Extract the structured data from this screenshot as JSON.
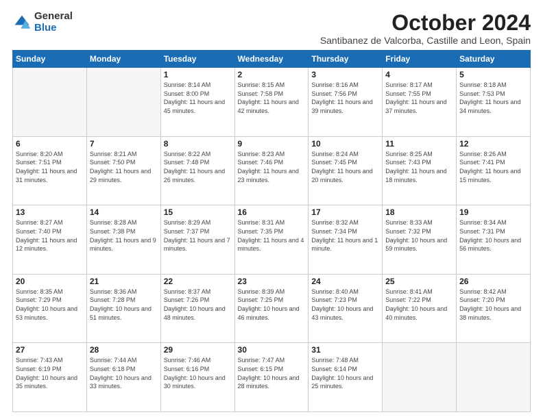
{
  "logo": {
    "general": "General",
    "blue": "Blue"
  },
  "title": {
    "month": "October 2024",
    "location": "Santibanez de Valcorba, Castille and Leon, Spain"
  },
  "weekdays": [
    "Sunday",
    "Monday",
    "Tuesday",
    "Wednesday",
    "Thursday",
    "Friday",
    "Saturday"
  ],
  "weeks": [
    [
      {
        "day": "",
        "info": ""
      },
      {
        "day": "",
        "info": ""
      },
      {
        "day": "1",
        "info": "Sunrise: 8:14 AM\nSunset: 8:00 PM\nDaylight: 11 hours and 45 minutes."
      },
      {
        "day": "2",
        "info": "Sunrise: 8:15 AM\nSunset: 7:58 PM\nDaylight: 11 hours and 42 minutes."
      },
      {
        "day": "3",
        "info": "Sunrise: 8:16 AM\nSunset: 7:56 PM\nDaylight: 11 hours and 39 minutes."
      },
      {
        "day": "4",
        "info": "Sunrise: 8:17 AM\nSunset: 7:55 PM\nDaylight: 11 hours and 37 minutes."
      },
      {
        "day": "5",
        "info": "Sunrise: 8:18 AM\nSunset: 7:53 PM\nDaylight: 11 hours and 34 minutes."
      }
    ],
    [
      {
        "day": "6",
        "info": "Sunrise: 8:20 AM\nSunset: 7:51 PM\nDaylight: 11 hours and 31 minutes."
      },
      {
        "day": "7",
        "info": "Sunrise: 8:21 AM\nSunset: 7:50 PM\nDaylight: 11 hours and 29 minutes."
      },
      {
        "day": "8",
        "info": "Sunrise: 8:22 AM\nSunset: 7:48 PM\nDaylight: 11 hours and 26 minutes."
      },
      {
        "day": "9",
        "info": "Sunrise: 8:23 AM\nSunset: 7:46 PM\nDaylight: 11 hours and 23 minutes."
      },
      {
        "day": "10",
        "info": "Sunrise: 8:24 AM\nSunset: 7:45 PM\nDaylight: 11 hours and 20 minutes."
      },
      {
        "day": "11",
        "info": "Sunrise: 8:25 AM\nSunset: 7:43 PM\nDaylight: 11 hours and 18 minutes."
      },
      {
        "day": "12",
        "info": "Sunrise: 8:26 AM\nSunset: 7:41 PM\nDaylight: 11 hours and 15 minutes."
      }
    ],
    [
      {
        "day": "13",
        "info": "Sunrise: 8:27 AM\nSunset: 7:40 PM\nDaylight: 11 hours and 12 minutes."
      },
      {
        "day": "14",
        "info": "Sunrise: 8:28 AM\nSunset: 7:38 PM\nDaylight: 11 hours and 9 minutes."
      },
      {
        "day": "15",
        "info": "Sunrise: 8:29 AM\nSunset: 7:37 PM\nDaylight: 11 hours and 7 minutes."
      },
      {
        "day": "16",
        "info": "Sunrise: 8:31 AM\nSunset: 7:35 PM\nDaylight: 11 hours and 4 minutes."
      },
      {
        "day": "17",
        "info": "Sunrise: 8:32 AM\nSunset: 7:34 PM\nDaylight: 11 hours and 1 minute."
      },
      {
        "day": "18",
        "info": "Sunrise: 8:33 AM\nSunset: 7:32 PM\nDaylight: 10 hours and 59 minutes."
      },
      {
        "day": "19",
        "info": "Sunrise: 8:34 AM\nSunset: 7:31 PM\nDaylight: 10 hours and 56 minutes."
      }
    ],
    [
      {
        "day": "20",
        "info": "Sunrise: 8:35 AM\nSunset: 7:29 PM\nDaylight: 10 hours and 53 minutes."
      },
      {
        "day": "21",
        "info": "Sunrise: 8:36 AM\nSunset: 7:28 PM\nDaylight: 10 hours and 51 minutes."
      },
      {
        "day": "22",
        "info": "Sunrise: 8:37 AM\nSunset: 7:26 PM\nDaylight: 10 hours and 48 minutes."
      },
      {
        "day": "23",
        "info": "Sunrise: 8:39 AM\nSunset: 7:25 PM\nDaylight: 10 hours and 46 minutes."
      },
      {
        "day": "24",
        "info": "Sunrise: 8:40 AM\nSunset: 7:23 PM\nDaylight: 10 hours and 43 minutes."
      },
      {
        "day": "25",
        "info": "Sunrise: 8:41 AM\nSunset: 7:22 PM\nDaylight: 10 hours and 40 minutes."
      },
      {
        "day": "26",
        "info": "Sunrise: 8:42 AM\nSunset: 7:20 PM\nDaylight: 10 hours and 38 minutes."
      }
    ],
    [
      {
        "day": "27",
        "info": "Sunrise: 7:43 AM\nSunset: 6:19 PM\nDaylight: 10 hours and 35 minutes."
      },
      {
        "day": "28",
        "info": "Sunrise: 7:44 AM\nSunset: 6:18 PM\nDaylight: 10 hours and 33 minutes."
      },
      {
        "day": "29",
        "info": "Sunrise: 7:46 AM\nSunset: 6:16 PM\nDaylight: 10 hours and 30 minutes."
      },
      {
        "day": "30",
        "info": "Sunrise: 7:47 AM\nSunset: 6:15 PM\nDaylight: 10 hours and 28 minutes."
      },
      {
        "day": "31",
        "info": "Sunrise: 7:48 AM\nSunset: 6:14 PM\nDaylight: 10 hours and 25 minutes."
      },
      {
        "day": "",
        "info": ""
      },
      {
        "day": "",
        "info": ""
      }
    ]
  ]
}
